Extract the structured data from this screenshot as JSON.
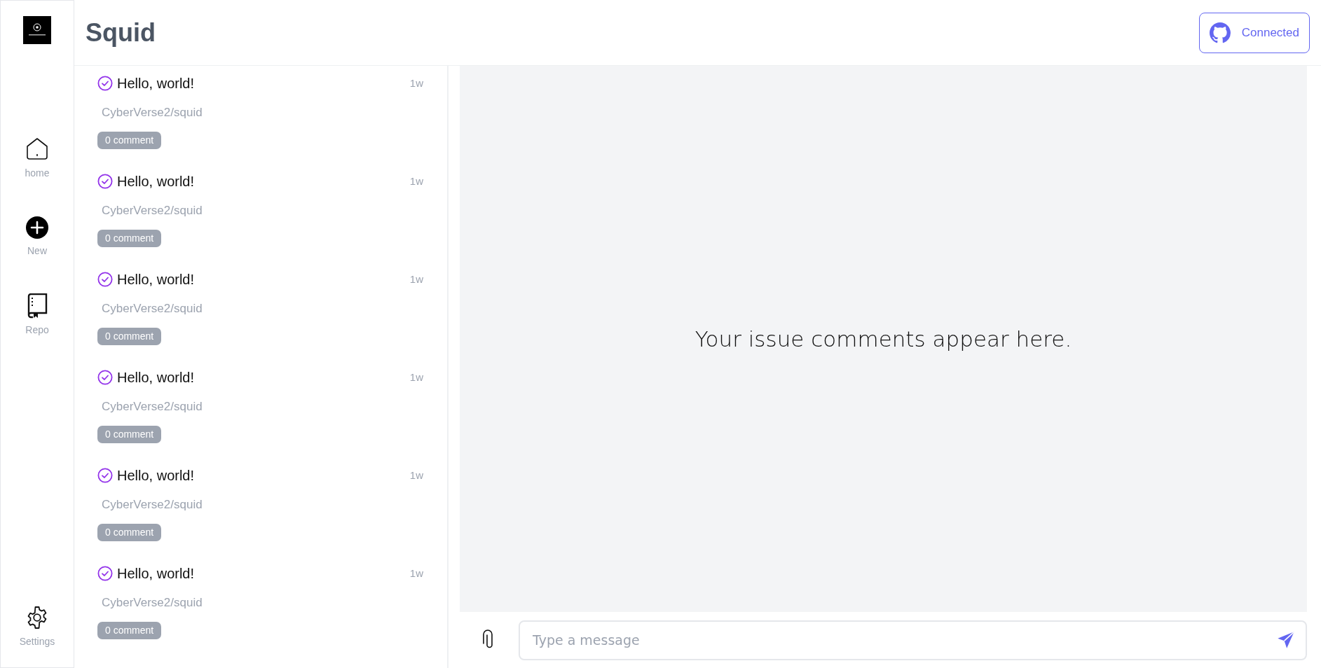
{
  "app": {
    "title": "Squid"
  },
  "sidebar": {
    "items": [
      {
        "label": "home",
        "kind": "home"
      },
      {
        "label": "New",
        "kind": "new"
      },
      {
        "label": "Repo",
        "kind": "repo"
      }
    ],
    "footer": {
      "label": "Settings",
      "kind": "settings"
    }
  },
  "connect_button": {
    "label": "Connected"
  },
  "issues": [
    {
      "title": "Hello, world!",
      "repo": "CyberVerse2/squid",
      "comments": "0 comment",
      "age": "1w"
    },
    {
      "title": "Hello, world!",
      "repo": "CyberVerse2/squid",
      "comments": "0 comment",
      "age": "1w"
    },
    {
      "title": "Hello, world!",
      "repo": "CyberVerse2/squid",
      "comments": "0 comment",
      "age": "1w"
    },
    {
      "title": "Hello, world!",
      "repo": "CyberVerse2/squid",
      "comments": "0 comment",
      "age": "1w"
    },
    {
      "title": "Hello, world!",
      "repo": "CyberVerse2/squid",
      "comments": "0 comment",
      "age": "1w"
    },
    {
      "title": "Hello, world!",
      "repo": "CyberVerse2/squid",
      "comments": "0 comment",
      "age": "1w"
    }
  ],
  "empty_state": "Your issue comments appear here.",
  "composer": {
    "placeholder": "Type a message"
  }
}
